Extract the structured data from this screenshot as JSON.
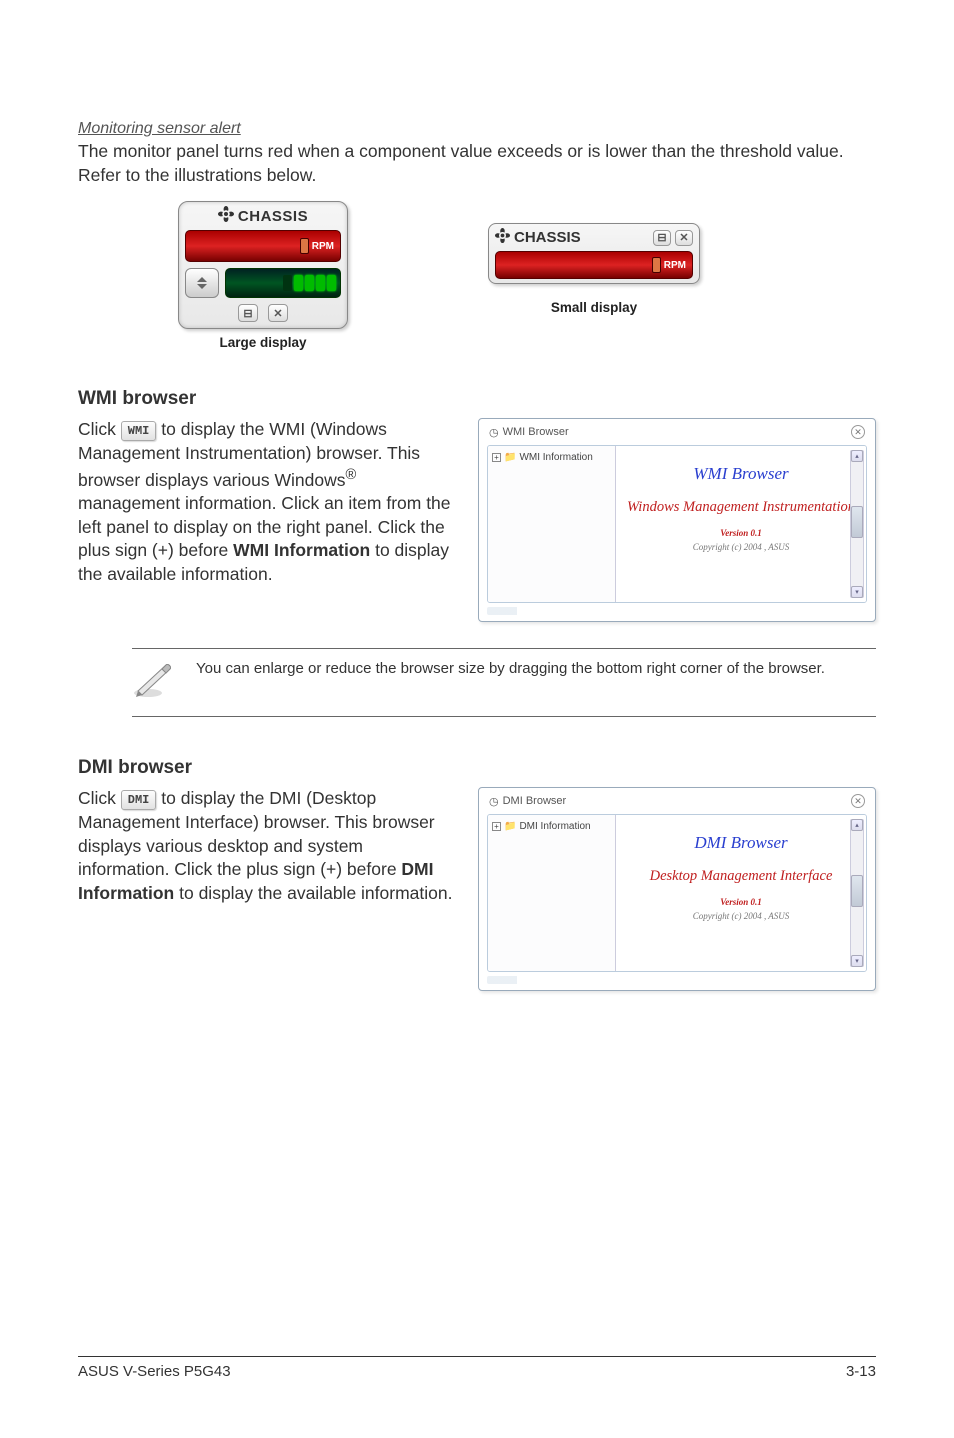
{
  "monitoring": {
    "heading": "Monitoring sensor alert",
    "body": "The monitor panel turns red when a component value exceeds or is lower than the threshold value. Refer to the illustrations below.",
    "large_label": "CHASSIS",
    "small_label": "CHASSIS",
    "rpm": "RPM",
    "large_caption": "Large display",
    "small_caption": "Small display"
  },
  "wmi": {
    "heading": "WMI browser",
    "click": "Click ",
    "btn": "WMI",
    "rest1": " to display the WMI (Windows Management Instrumentation) browser. This browser displays various Windows",
    "rest2": " management information. Click an item from the left panel to display on the right panel. Click the plus sign (+) before ",
    "bold": "WMI Information",
    "rest3": " to display the available information.",
    "browser": {
      "title": "WMI Browser",
      "tree_root": "WMI Information",
      "content_title": "WMI  Browser",
      "content_sub": "Windows Management Instrumentation",
      "version": "Version 0.1",
      "copyright": "Copyright (c) 2004 ,  ASUS"
    }
  },
  "note": "You can enlarge or reduce the browser size by dragging the bottom right corner of the browser.",
  "dmi": {
    "heading": "DMI browser",
    "click": "Click ",
    "btn": "DMI",
    "rest1": " to display the DMI (Desktop Management Interface) browser. This browser displays various desktop and system information. Click the plus sign (+) before ",
    "bold": "DMI Information",
    "rest2": " to display the available information.",
    "browser": {
      "title": "DMI Browser",
      "tree_root": "DMI Information",
      "content_title": "DMI  Browser",
      "content_sub": "Desktop Management Interface",
      "version": "Version 0.1",
      "copyright": "Copyright (c) 2004 ,  ASUS"
    }
  },
  "footer": {
    "left": "ASUS V-Series P5G43",
    "right": "3-13"
  }
}
